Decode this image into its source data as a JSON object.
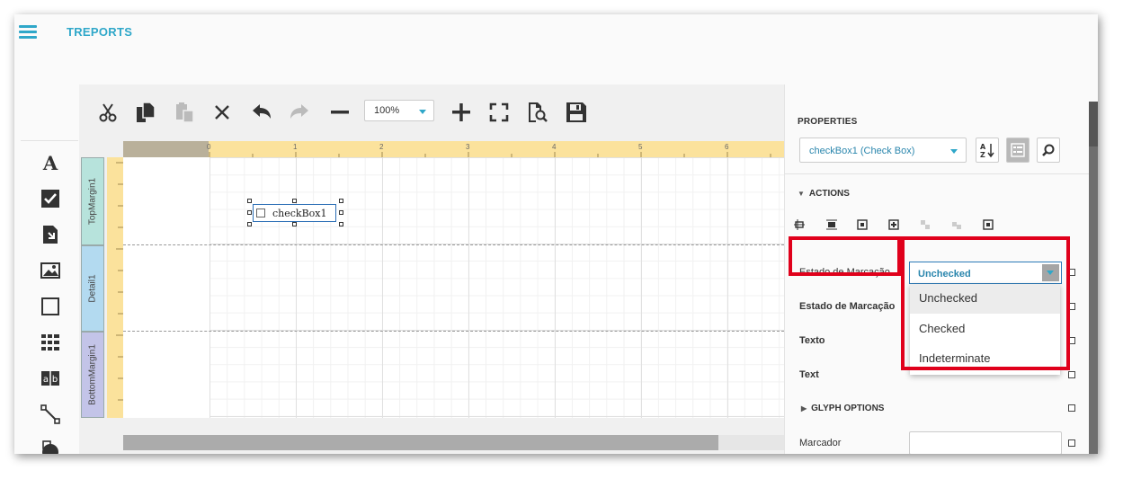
{
  "app": {
    "title": "TREPORTS"
  },
  "toolbar": {
    "zoom_value": "100%"
  },
  "ruler": {
    "ticks": [
      "0",
      "1",
      "2",
      "3",
      "4",
      "5",
      "6"
    ]
  },
  "bands": [
    "TopMargin1",
    "Detail1",
    "BottomMargin1"
  ],
  "control": {
    "label": "checkBox1"
  },
  "properties": {
    "title": "PROPERTIES",
    "selected_component": "checkBox1 (Check Box)",
    "actions_section": "ACTIONS",
    "glyph_section": "GLYPH OPTIONS",
    "rows": {
      "estado_marcacao_action": "Estado de Marcação",
      "estado_marcacao": "Estado de Marcação",
      "texto": "Texto",
      "text": "Text",
      "marcador": "Marcador"
    },
    "check_state": {
      "value": "Unchecked",
      "options": [
        "Unchecked",
        "Checked",
        "Indeterminate"
      ]
    }
  },
  "colors": {
    "accent": "#2fa7c9",
    "highlight_box": "#e0001b",
    "selection": "#2c6fb6"
  }
}
